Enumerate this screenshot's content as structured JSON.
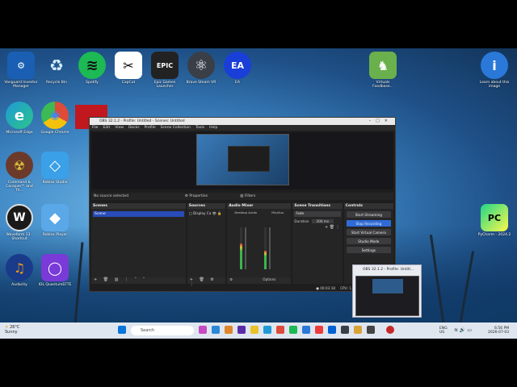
{
  "desktop_icons": [
    {
      "id": "vanguard",
      "label": "Vanguard Investor Manager",
      "color": "#1a5fb4",
      "glyph": "⚙"
    },
    {
      "id": "recycle",
      "label": "Recycle Bin",
      "color": "#5aa0d8",
      "glyph": "♻"
    },
    {
      "id": "spotify",
      "label": "Spotify",
      "color": "#1db954",
      "glyph": "≋"
    },
    {
      "id": "capcut",
      "label": "CapCut",
      "color": "#ffffff",
      "glyph": "✂"
    },
    {
      "id": "epic",
      "label": "Epic Games Launcher",
      "color": "#222222",
      "glyph": "EPIC"
    },
    {
      "id": "atom",
      "label": "Brave Steam VR",
      "color": "#3a3f47",
      "glyph": "⚛"
    },
    {
      "id": "ea",
      "label": "EA",
      "color": "#1a3fd8",
      "glyph": "EA"
    },
    {
      "id": "edge",
      "label": "Microsoft Edge",
      "color": "#1f9ad6",
      "glyph": "e"
    },
    {
      "id": "chrome",
      "label": "Google Chrome",
      "color": "#dd4b39",
      "glyph": "◉"
    },
    {
      "id": "commandconquer",
      "label": "Command & Conquer™ and Th...",
      "color": "#6b3a2b",
      "glyph": "☢"
    },
    {
      "id": "roblox-studio",
      "label": "Roblox Studio",
      "color": "#3aa0e8",
      "glyph": "◇"
    },
    {
      "id": "wavefrom",
      "label": "Waveform 13 - Shortcut",
      "color": "#1a1a1a",
      "glyph": "W"
    },
    {
      "id": "roblox",
      "label": "Roblox Player",
      "color": "#5ba8e8",
      "glyph": "◆"
    },
    {
      "id": "audacity",
      "label": "Audacity",
      "color": "#1a3a8a",
      "glyph": "♫"
    },
    {
      "id": "quantum",
      "label": "IDL QuantumEFTE",
      "color": "#7a3ad8",
      "glyph": "◯"
    },
    {
      "id": "idle",
      "label": "Virtuals Foodbase...",
      "color": "#6ab04c",
      "glyph": "♞"
    },
    {
      "id": "learn",
      "label": "Learn about this image",
      "color": "#2a78d8",
      "glyph": "i"
    },
    {
      "id": "pycharm",
      "label": "PyCharm - 2024.2",
      "color": "#1a1a1a",
      "glyph": "PC"
    }
  ],
  "obs": {
    "title": "OBS 32.1.2 - Profile: Untitled - Scenes: Untitled",
    "menu": [
      "File",
      "Edit",
      "View",
      "Docks",
      "Profile",
      "Scene Collection",
      "Tools",
      "Help"
    ],
    "status_left": "No source selected",
    "status_props": "Properties",
    "status_filters": "Filters",
    "docks": {
      "scenes": {
        "title": "Scenes",
        "items": [
          "Scene"
        ]
      },
      "sources": {
        "title": "Sources",
        "items": [
          "Display Ca"
        ]
      },
      "mixer": {
        "title": "Audio Mixer",
        "channels": [
          {
            "name": "Desktop Audio",
            "level": 0.62
          },
          {
            "name": "Mic/Aux",
            "level": 0.45
          }
        ],
        "global": "Global",
        "options": "Options"
      },
      "transitions": {
        "title": "Scene Transitions",
        "type": "Fade",
        "duration_label": "Duration",
        "duration": "300 ms"
      },
      "controls": {
        "title": "Controls",
        "buttons": [
          "Start Streaming",
          "Stop Recording",
          "Start Virtual Camera",
          "Studio Mode",
          "Settings"
        ]
      }
    },
    "rec_time": "00:03:18",
    "cpu": "CPU: 1..."
  },
  "taskbar": {
    "weather_temp": "26°C",
    "weather_desc": "Sunny",
    "search_placeholder": "Search",
    "lang": "ENG",
    "lang_region": "US",
    "time": "6:56 PM",
    "date": "2026-07-03"
  },
  "popup": {
    "title": "OBS 32.1.2 - Profile: Untitl..."
  }
}
